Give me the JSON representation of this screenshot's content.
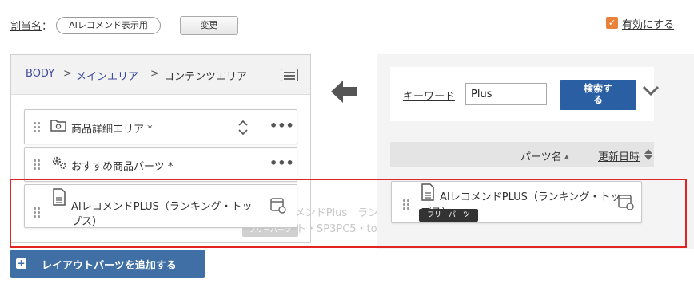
{
  "assignment": {
    "label": "割当名",
    "colon": "：",
    "value": "AIレコメンド表示用",
    "change_button": "変更"
  },
  "enable": {
    "checked": true,
    "label": "有効にする",
    "check_mark": "✓"
  },
  "layout_panel": {
    "breadcrumb": [
      "BODY",
      "メインエリア",
      "コンテンツエリア"
    ],
    "separator": ">",
    "items": [
      {
        "label": "商品詳細エリア *",
        "icon": "folder-gear-icon"
      },
      {
        "label": "おすすめ商品パーツ *",
        "icon": "gears-icon"
      },
      {
        "label_line1": "AIレコメンドPLUS（ランキング・トッ",
        "label_line2": "プス）",
        "icon": "document-code-icon"
      }
    ],
    "more_glyph": "•••"
  },
  "search_panel": {
    "keyword_label": "キーワード",
    "keyword_value": "Plus",
    "search_button_line1": "検索す",
    "search_button_line2": "る",
    "sort_parts": "パーツ名",
    "sort_parts_arrow": "▲",
    "sort_date": "更新日時",
    "result": {
      "label_line1": "AIレコメンドPLUS（ランキング・トッ",
      "label_line2": "プス）",
      "badge": "フリーパーツ"
    }
  },
  "ghost": {
    "line1": "AIレコメンドPlus　ランキ…",
    "line2": "…ト・SP3PC5・towelフィルタ",
    "badge": "フリーパーツ"
  },
  "add_button": {
    "plus": "+",
    "label": "レイアウトパーツを追加する"
  },
  "colors": {
    "accent_orange": "#e8823a",
    "primary_blue": "#2b5fa4",
    "add_button_blue": "#3f6fa5",
    "highlight_red": "#e02424"
  }
}
